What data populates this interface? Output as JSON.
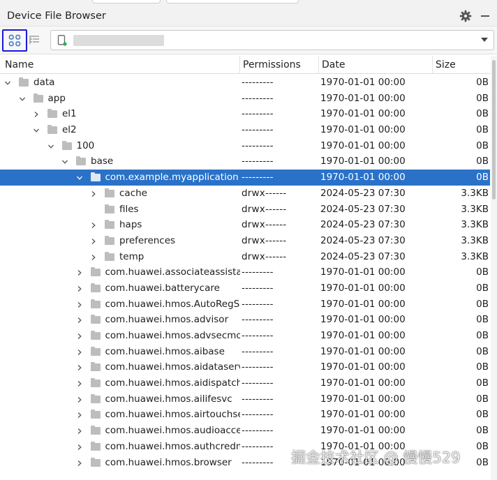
{
  "panel": {
    "title": "Device File Browser"
  },
  "columns": {
    "name": "Name",
    "permissions": "Permissions",
    "date": "Date",
    "size": "Size"
  },
  "selected_index": 6,
  "rows": [
    {
      "depth": 0,
      "expander": "expanded",
      "name": "data",
      "permissions": "---------",
      "date": "1970-01-01 00:00",
      "size": "0B"
    },
    {
      "depth": 1,
      "expander": "expanded",
      "name": "app",
      "permissions": "---------",
      "date": "1970-01-01 00:00",
      "size": "0B"
    },
    {
      "depth": 2,
      "expander": "collapsed",
      "name": "el1",
      "permissions": "---------",
      "date": "1970-01-01 00:00",
      "size": "0B"
    },
    {
      "depth": 2,
      "expander": "expanded",
      "name": "el2",
      "permissions": "---------",
      "date": "1970-01-01 00:00",
      "size": "0B"
    },
    {
      "depth": 3,
      "expander": "expanded",
      "name": "100",
      "permissions": "---------",
      "date": "1970-01-01 00:00",
      "size": "0B"
    },
    {
      "depth": 4,
      "expander": "expanded",
      "name": "base",
      "permissions": "---------",
      "date": "1970-01-01 00:00",
      "size": "0B"
    },
    {
      "depth": 5,
      "expander": "expanded",
      "name": "com.example.myapplication",
      "permissions": "---------",
      "date": "1970-01-01 00:00",
      "size": "0B"
    },
    {
      "depth": 6,
      "expander": "collapsed",
      "name": "cache",
      "permissions": "drwx------",
      "date": "2024-05-23 07:30",
      "size": "3.3KB"
    },
    {
      "depth": 6,
      "expander": "none",
      "name": "files",
      "permissions": "drwx------",
      "date": "2024-05-23 07:30",
      "size": "3.3KB"
    },
    {
      "depth": 6,
      "expander": "collapsed",
      "name": "haps",
      "permissions": "drwx------",
      "date": "2024-05-23 07:30",
      "size": "3.3KB"
    },
    {
      "depth": 6,
      "expander": "collapsed",
      "name": "preferences",
      "permissions": "drwx------",
      "date": "2024-05-23 07:30",
      "size": "3.3KB"
    },
    {
      "depth": 6,
      "expander": "collapsed",
      "name": "temp",
      "permissions": "drwx------",
      "date": "2024-05-23 07:30",
      "size": "3.3KB"
    },
    {
      "depth": 5,
      "expander": "collapsed",
      "name": "com.huawei.associateassistan",
      "permissions": "---------",
      "date": "1970-01-01 00:00",
      "size": "0B"
    },
    {
      "depth": 5,
      "expander": "collapsed",
      "name": "com.huawei.batterycare",
      "permissions": "---------",
      "date": "1970-01-01 00:00",
      "size": "0B"
    },
    {
      "depth": 5,
      "expander": "collapsed",
      "name": "com.huawei.hmos.AutoRegSe",
      "permissions": "---------",
      "date": "1970-01-01 00:00",
      "size": "0B"
    },
    {
      "depth": 5,
      "expander": "collapsed",
      "name": "com.huawei.hmos.advisor",
      "permissions": "---------",
      "date": "1970-01-01 00:00",
      "size": "0B"
    },
    {
      "depth": 5,
      "expander": "collapsed",
      "name": "com.huawei.hmos.advsecmod",
      "permissions": "---------",
      "date": "1970-01-01 00:00",
      "size": "0B"
    },
    {
      "depth": 5,
      "expander": "collapsed",
      "name": "com.huawei.hmos.aibase",
      "permissions": "---------",
      "date": "1970-01-01 00:00",
      "size": "0B"
    },
    {
      "depth": 5,
      "expander": "collapsed",
      "name": "com.huawei.hmos.aidataservi",
      "permissions": "---------",
      "date": "1970-01-01 00:00",
      "size": "0B"
    },
    {
      "depth": 5,
      "expander": "collapsed",
      "name": "com.huawei.hmos.aidispatchs",
      "permissions": "---------",
      "date": "1970-01-01 00:00",
      "size": "0B"
    },
    {
      "depth": 5,
      "expander": "collapsed",
      "name": "com.huawei.hmos.ailifesvc",
      "permissions": "---------",
      "date": "1970-01-01 00:00",
      "size": "0B"
    },
    {
      "depth": 5,
      "expander": "collapsed",
      "name": "com.huawei.hmos.airtouchser",
      "permissions": "---------",
      "date": "1970-01-01 00:00",
      "size": "0B"
    },
    {
      "depth": 5,
      "expander": "collapsed",
      "name": "com.huawei.hmos.audioacces",
      "permissions": "---------",
      "date": "1970-01-01 00:00",
      "size": "0B"
    },
    {
      "depth": 5,
      "expander": "collapsed",
      "name": "com.huawei.hmos.authcredmg",
      "permissions": "---------",
      "date": "1970-01-01 00:00",
      "size": "0B"
    },
    {
      "depth": 5,
      "expander": "collapsed",
      "name": "com.huawei.hmos.browser",
      "permissions": "---------",
      "date": "1970-01-01 00:00",
      "size": "0B"
    }
  ],
  "icons": {
    "settings": "gear-icon",
    "hide": "minimize-icon",
    "toolbar_primary": "grid-view-icon",
    "toolbar_secondary": "list-view-icon",
    "device": "phone-icon",
    "dropdown": "chevron-down-icon",
    "folder": "folder-icon",
    "expand": "chevron-right-icon",
    "collapse": "chevron-down-icon"
  },
  "colors": {
    "selection": "#2a72c8",
    "focus_outline": "#1a17d6",
    "folder": "#bdbdbd",
    "device_status": "#2bb24c"
  },
  "watermark": "掘金技术社区 @ 慢慢529"
}
